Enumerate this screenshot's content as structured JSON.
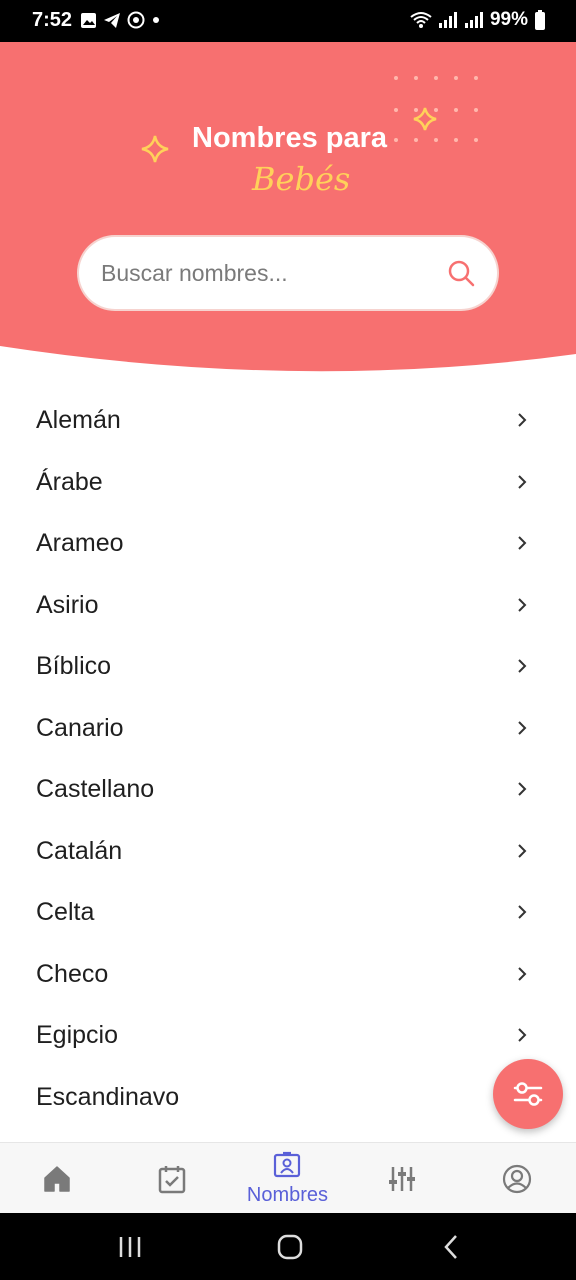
{
  "status_bar": {
    "time": "7:52",
    "battery": "99%"
  },
  "header": {
    "title_line1": "Nombres para",
    "title_line2": "Bebés"
  },
  "search": {
    "placeholder": "Buscar nombres..."
  },
  "categories": [
    "Alemán",
    "Árabe",
    "Arameo",
    "Asirio",
    "Bíblico",
    "Canario",
    "Castellano",
    "Catalán",
    "Celta",
    "Checo",
    "Egipcio",
    "Escandinavo"
  ],
  "bottom_nav": {
    "items": [
      {
        "icon": "home-icon"
      },
      {
        "icon": "calendar-check-icon"
      },
      {
        "icon": "id-badge-icon",
        "label": "Nombres",
        "active": true
      },
      {
        "icon": "sliders-icon"
      },
      {
        "icon": "profile-icon"
      }
    ]
  },
  "colors": {
    "header": "#f77070",
    "accent": "#5a60d8",
    "title_script": "#ffd15a"
  }
}
